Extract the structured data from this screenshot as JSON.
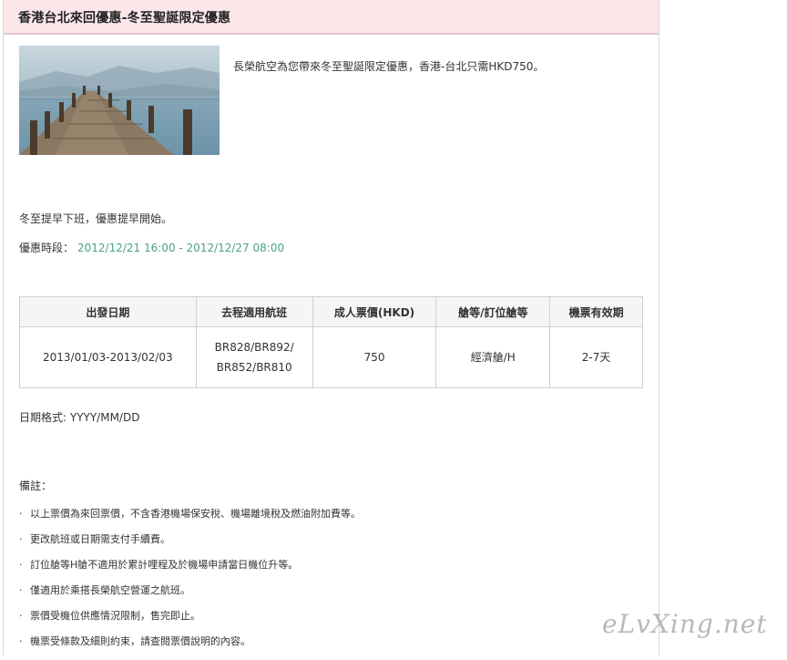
{
  "header": {
    "title": "香港台北來回優惠-冬至聖誕限定優惠"
  },
  "intro": "長榮航空為您帶來冬至聖誕限定優惠，香港-台北只需HKD750。",
  "line1": "冬至提早下班，優惠提早開始。",
  "period": {
    "label": "優惠時段：",
    "value": "2012/12/21 16:00 - 2012/12/27 08:00"
  },
  "table": {
    "headers": [
      "出發日期",
      "去程適用航班",
      "成人票價(HKD)",
      "艙等/訂位艙等",
      "機票有效期"
    ],
    "row": {
      "date": "2013/01/03-2013/02/03",
      "flights_line1": "BR828/BR892/",
      "flights_line2": "BR852/BR810",
      "fare": "750",
      "cabin": "經濟艙/H",
      "validity": "2-7天"
    }
  },
  "date_format": "日期格式: YYYY/MM/DD",
  "notes_title": "備註：",
  "notes": [
    "以上票價為來回票價，不含香港機場保安稅、機場離境稅及燃油附加費等。",
    "更改航班或日期需支付手續費。",
    "訂位艙等H艙不適用於累計哩程及於機場申請當日機位升等。",
    "僅適用於乘搭長榮航空營運之航班。",
    "票價受機位供應情況限制，售完即止。",
    "機票受條款及細則約束，請查閱票價說明的內容。"
  ],
  "watermark": "eLvXing.net"
}
